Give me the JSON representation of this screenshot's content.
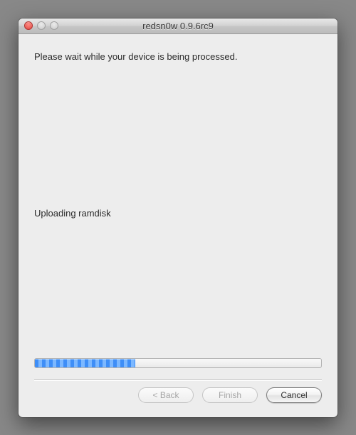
{
  "window": {
    "title": "redsn0w 0.9.6rc9"
  },
  "content": {
    "message": "Please wait while your device is being processed.",
    "status": "Uploading ramdisk",
    "progress_percent": 35
  },
  "buttons": {
    "back_label": "< Back",
    "finish_label": "Finish",
    "cancel_label": "Cancel",
    "back_enabled": false,
    "finish_enabled": false,
    "cancel_enabled": true
  }
}
